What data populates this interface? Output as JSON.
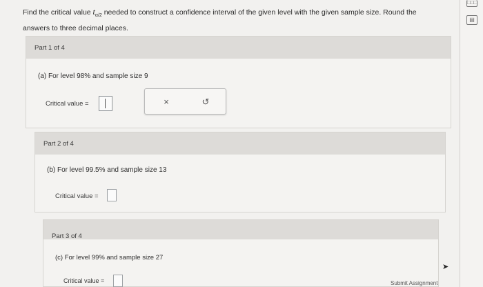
{
  "instructions": {
    "line1_pre": "Find the critical value ",
    "t_symbol": "t",
    "subscript": "α/2",
    "line1_post": " needed to construct a confidence interval of the given level with the given sample size. Round the",
    "line2": "answers to three decimal places."
  },
  "parts": [
    {
      "header": "Part 1 of 4",
      "question": "(a) For level 98% and sample size 9",
      "label": "Critical value ="
    },
    {
      "header": "Part 2 of 4",
      "question": "(b) For level 99.5% and sample size 13",
      "label": "Critical value ="
    },
    {
      "header": "Part 3 of 4",
      "question": "(c) For level 99% and sample size 27",
      "label": "Critical value ="
    }
  ],
  "toolbar": {
    "clear_icon": "×",
    "undo_icon": "↺"
  },
  "sidebar": {
    "icon1": "□□□",
    "icon2": "▤"
  },
  "footer": {
    "submit": "Submit Assignment"
  }
}
